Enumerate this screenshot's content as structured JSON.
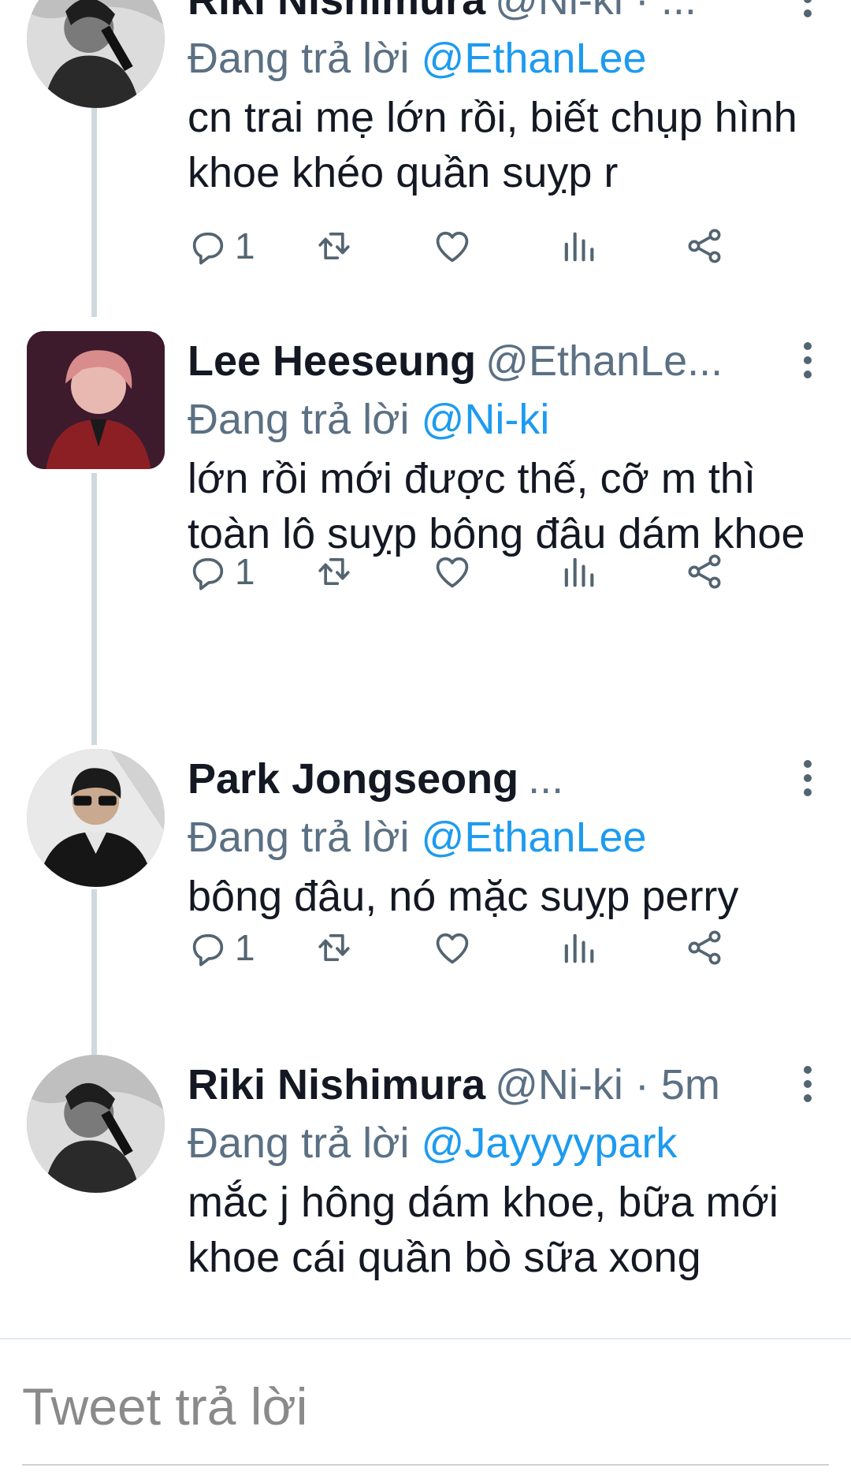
{
  "tweets": [
    {
      "name": "Riki Nishimura",
      "handle": "@Ni-ki",
      "meta": " · ...",
      "replying_prefix": "Đang trả lời ",
      "replying_to": "@EthanLee",
      "text": "cn trai mẹ lớn rồi, biết chụp hình khoe khéo quần suỵp r",
      "reply_count": "1"
    },
    {
      "name": "Lee Heeseung",
      "handle": "@EthanLe...",
      "meta": "",
      "replying_prefix": "Đang trả lời ",
      "replying_to": "@Ni-ki",
      "text": "lớn rồi mới được thế, cỡ m thì toàn lô suỵp bông đâu dám khoe",
      "reply_count": "1"
    },
    {
      "name": "Park Jongseong",
      "handle": "...",
      "meta": "",
      "replying_prefix": "Đang trả lời ",
      "replying_to": "@EthanLee",
      "text": "bông đâu, nó mặc suỵp perry",
      "reply_count": "1"
    },
    {
      "name": "Riki Nishimura",
      "handle": "@Ni-ki",
      "meta": " · 5m",
      "replying_prefix": "Đang trả lời ",
      "replying_to": "@Jayyyypark",
      "text": "mắc j hông dám khoe, bữa mới khoe cái quần bò sữa xong",
      "reply_count": ""
    }
  ],
  "compose": {
    "placeholder": "Tweet trả lời"
  },
  "icons": [
    "reply-icon",
    "retweet-icon",
    "like-icon",
    "analytics-icon",
    "share-icon",
    "more-options-icon"
  ],
  "colors": {
    "accent": "#1d9bf0",
    "secondary_text": "#5b7083",
    "thread_line": "#cfd9de"
  }
}
